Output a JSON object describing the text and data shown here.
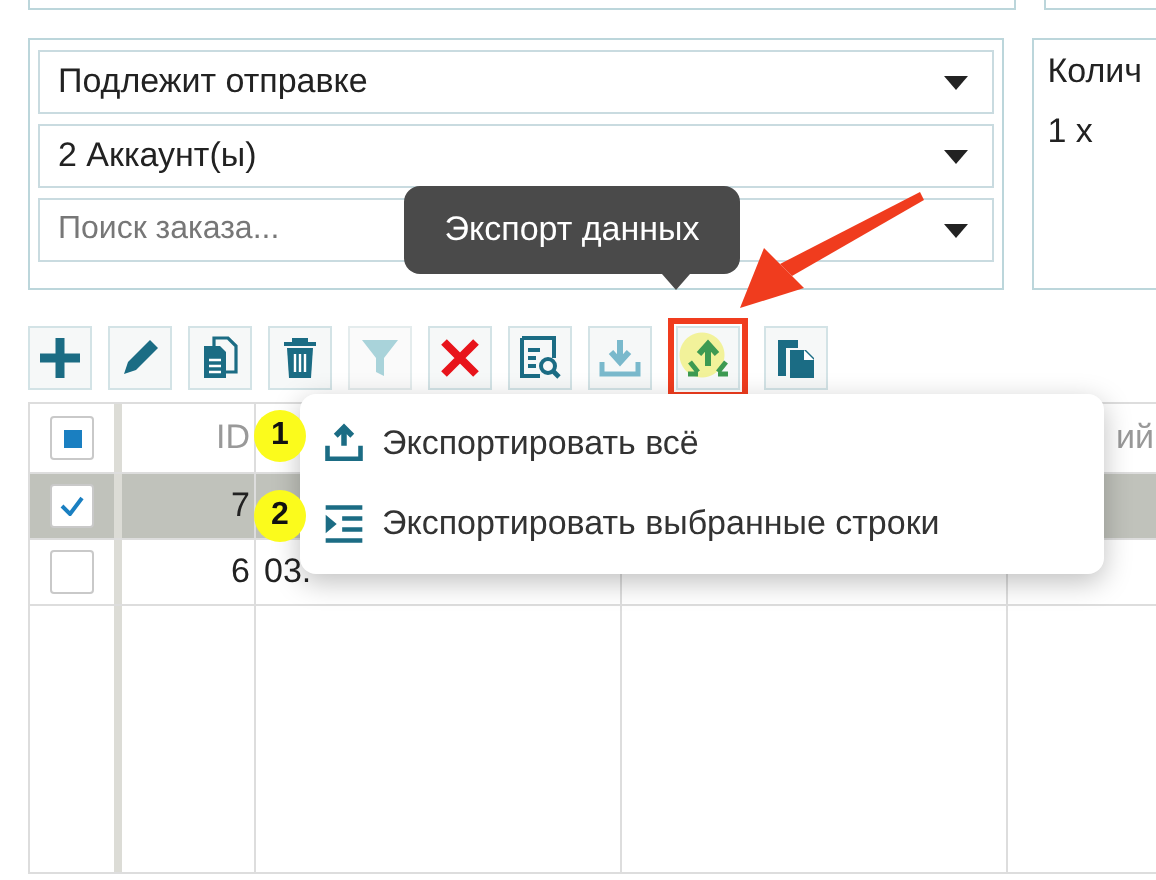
{
  "filters": [
    {
      "kind": "dropdown",
      "value": "Подлежит отправке"
    },
    {
      "kind": "dropdown",
      "value": "2 Аккаунт(ы)"
    },
    {
      "kind": "search",
      "placeholder": "Поиск заказа..."
    }
  ],
  "side_panel": {
    "label": "Колич",
    "value": "1 x"
  },
  "toolbar": [
    {
      "kind": "add",
      "disabled": false,
      "highlighted": false
    },
    {
      "kind": "edit",
      "disabled": false,
      "highlighted": false
    },
    {
      "kind": "copy",
      "disabled": false,
      "highlighted": false
    },
    {
      "kind": "delete",
      "disabled": false,
      "highlighted": false
    },
    {
      "kind": "filter",
      "disabled": true,
      "highlighted": false
    },
    {
      "kind": "clear",
      "disabled": false,
      "highlighted": false
    },
    {
      "kind": "preview",
      "disabled": false,
      "highlighted": false
    },
    {
      "kind": "import",
      "disabled": false,
      "highlighted": false
    },
    {
      "kind": "export",
      "disabled": false,
      "highlighted": true
    },
    {
      "kind": "paste",
      "disabled": false,
      "highlighted": false
    }
  ],
  "tooltip": {
    "text": "Экспорт данных"
  },
  "table": {
    "select_all": {
      "indeterminate": true
    },
    "columns": [
      {
        "label": "ID"
      },
      {},
      {},
      {
        "label": "ий"
      }
    ],
    "rows": [
      {
        "selected": true,
        "checked": true,
        "cells": [
          "7"
        ]
      },
      {
        "selected": false,
        "checked": false,
        "cells": [
          "6",
          "03."
        ]
      }
    ]
  },
  "menu": {
    "items": [
      {
        "kind": "upload",
        "label": "Экспортировать всё",
        "badge": "1"
      },
      {
        "kind": "rows",
        "label": "Экспортировать выбранные строки",
        "badge": "2"
      }
    ]
  }
}
